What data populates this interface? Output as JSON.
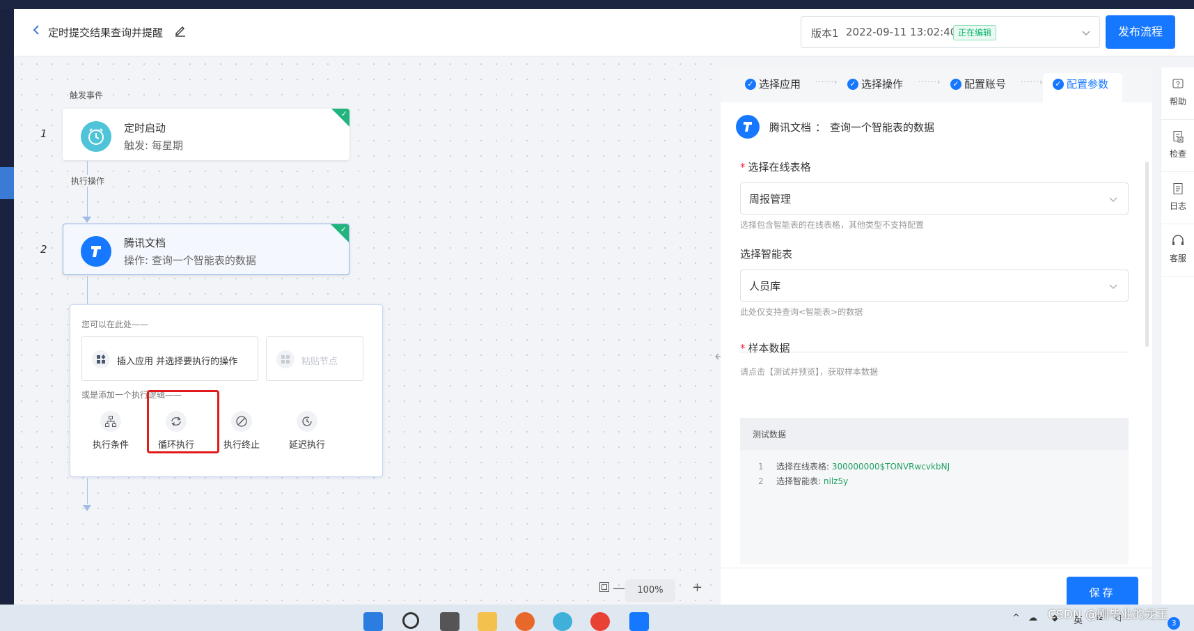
{
  "header": {
    "title": "定时提交结果查询并提醒",
    "version_label": "版本1",
    "version_date": "2022-09-11 13:02:40",
    "version_status": "正在编辑",
    "publish_label": "发布流程"
  },
  "canvas": {
    "trigger_label": "触发事件",
    "action_label": "执行操作",
    "nodes": [
      {
        "index": "1",
        "title": "定时启动",
        "subtitle": "触发: 每星期",
        "icon": "alarm-clock-icon",
        "color": "#4fc3d8"
      },
      {
        "index": "2",
        "title": "腾讯文档",
        "subtitle": "操作: 查询一个智能表的数据",
        "icon": "tencent-docs-icon",
        "color": "#1677ff"
      }
    ],
    "add_panel": {
      "hint_here": "您可以在此处——",
      "insert_app": "插入应用 并选择要执行的操作",
      "paste_node": "粘贴节点",
      "hint_logic": "或是添加一个执行逻辑——",
      "logic_items": [
        {
          "label": "执行条件",
          "icon": "branch-icon"
        },
        {
          "label": "循环执行",
          "icon": "loop-icon"
        },
        {
          "label": "执行终止",
          "icon": "stop-icon"
        },
        {
          "label": "延迟执行",
          "icon": "delay-clock-icon"
        }
      ]
    },
    "zoom_value": "100%"
  },
  "panel": {
    "steps": [
      "选择应用",
      "选择操作",
      "配置账号",
      "配置参数"
    ],
    "active_step": "配置参数",
    "app_name": "腾讯文档",
    "app_sep": "：",
    "app_action": "查询一个智能表的数据",
    "fields": {
      "sheet_label": "选择在线表格",
      "sheet_value": "周报管理",
      "sheet_hint": "选择包含智能表的在线表格，其他类型不支持配置",
      "table_label": "选择智能表",
      "table_value": "人员库",
      "table_hint": "此处仅支持查询<智能表>的数据",
      "sample_label": "样本数据",
      "sample_hint": "请点击【测试并预览】，获取样本数据"
    },
    "sample": {
      "header": "测试数据",
      "lines": [
        {
          "no": "1",
          "key": "选择在线表格:",
          "value": "300000000$TONVRwcvkbNJ"
        },
        {
          "no": "2",
          "key": "选择智能表:",
          "value": "nilz5y"
        }
      ]
    },
    "save_label": "保存"
  },
  "rightbar": [
    {
      "label": "帮助",
      "icon": "help-icon"
    },
    {
      "label": "检查",
      "icon": "check-doc-icon"
    },
    {
      "label": "日志",
      "icon": "log-icon"
    },
    {
      "label": "客服",
      "icon": "headset-icon"
    }
  ],
  "taskbar": {
    "ime": "英",
    "watermark": "CSDN @刚毕业的龙王",
    "notification_count": "3"
  },
  "colors": {
    "accent": "#1677ff",
    "success": "#21b47d",
    "highlight": "#e11b1b"
  }
}
